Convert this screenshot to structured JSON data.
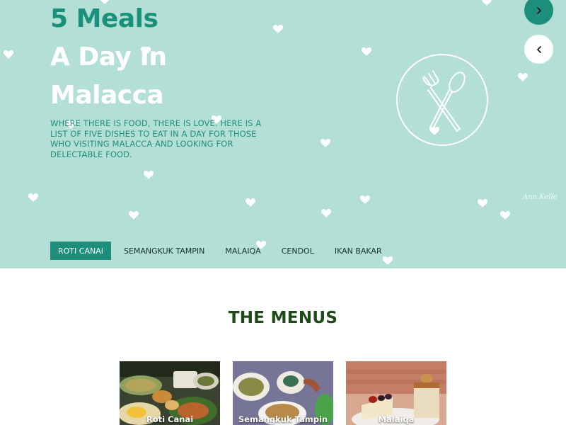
{
  "hero": {
    "title_line1": "5 Meals",
    "title_line2": "A Day In",
    "title_line3": "Malacca",
    "subtitle": "WHERE THERE IS FOOD, THERE IS LOVE. HERE IS A LIST OF FIVE DISHES TO EAT IN A DAY FOR THOSE WHO VISITING MALACCA AND LOOKING FOR DELECTABLE FOOD.",
    "signature": "Ann Kelle",
    "emblem_icon": "fork-and-spoon-icon",
    "next_icon": "chevron-right-icon",
    "prev_icon": "chevron-left-icon"
  },
  "tabs": [
    {
      "label": "ROTI CANAI",
      "active": true
    },
    {
      "label": "SEMANGKUK TAMPIN",
      "active": false
    },
    {
      "label": "MALAIQA",
      "active": false
    },
    {
      "label": "CENDOL",
      "active": false
    },
    {
      "label": "IKAN BAKAR",
      "active": false
    }
  ],
  "menus": {
    "title": "THE MENUS",
    "cards": [
      {
        "caption": "Roti Canai"
      },
      {
        "caption": "Semangkuk Tampin"
      },
      {
        "caption": "Malaiqa"
      }
    ]
  },
  "colors": {
    "hero_bg": "#b4dfd6",
    "accent": "#1c8e7b",
    "menus_title": "#1d4a17"
  }
}
